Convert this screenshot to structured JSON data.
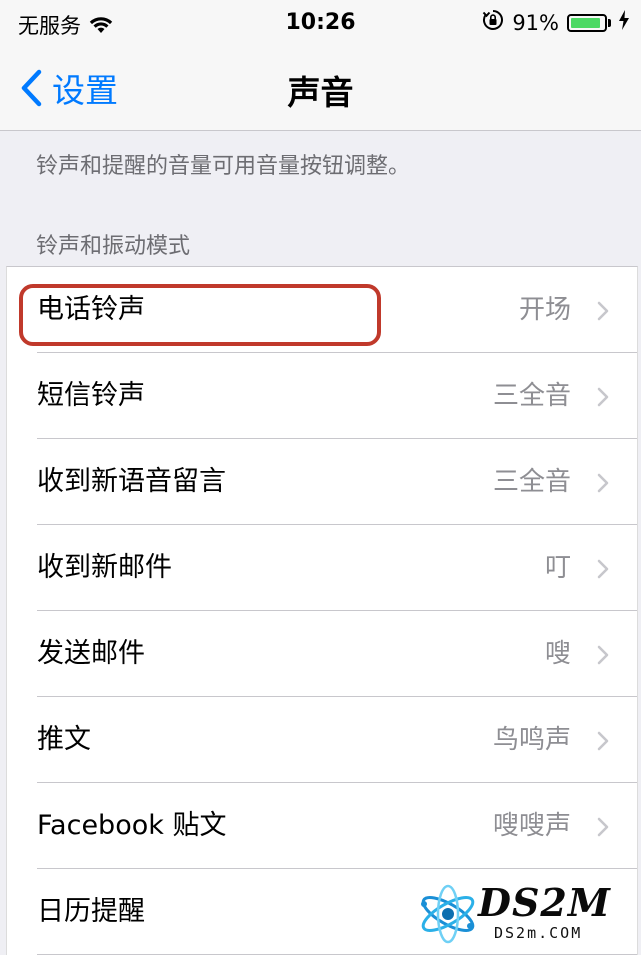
{
  "status_bar": {
    "carrier": "无服务",
    "time": "10:26",
    "battery_percent": "91%",
    "battery_level": 0.91,
    "battery_color": "#4cd964",
    "icons": [
      "wifi-icon",
      "rotation-lock-icon",
      "battery-icon",
      "charging-bolt-icon"
    ]
  },
  "nav": {
    "back_label": "设置",
    "title": "声音",
    "accent_color": "#007aff"
  },
  "section_note": "铃声和提醒的音量可用音量按钮调整。",
  "section_header": "铃声和振动模式",
  "rows": [
    {
      "label": "电话铃声",
      "value": "开场"
    },
    {
      "label": "短信铃声",
      "value": "三全音"
    },
    {
      "label": "收到新语音留言",
      "value": "三全音"
    },
    {
      "label": "收到新邮件",
      "value": "叮"
    },
    {
      "label": "发送邮件",
      "value": "嗖"
    },
    {
      "label": "推文",
      "value": "鸟鸣声"
    },
    {
      "label": "Facebook 贴文",
      "value": "嗖嗖声"
    },
    {
      "label": "日历提醒",
      "value": ""
    }
  ],
  "highlight_color": "#c0392b",
  "watermark": {
    "brand": "DS2M",
    "domain": "DS2m.COM"
  }
}
